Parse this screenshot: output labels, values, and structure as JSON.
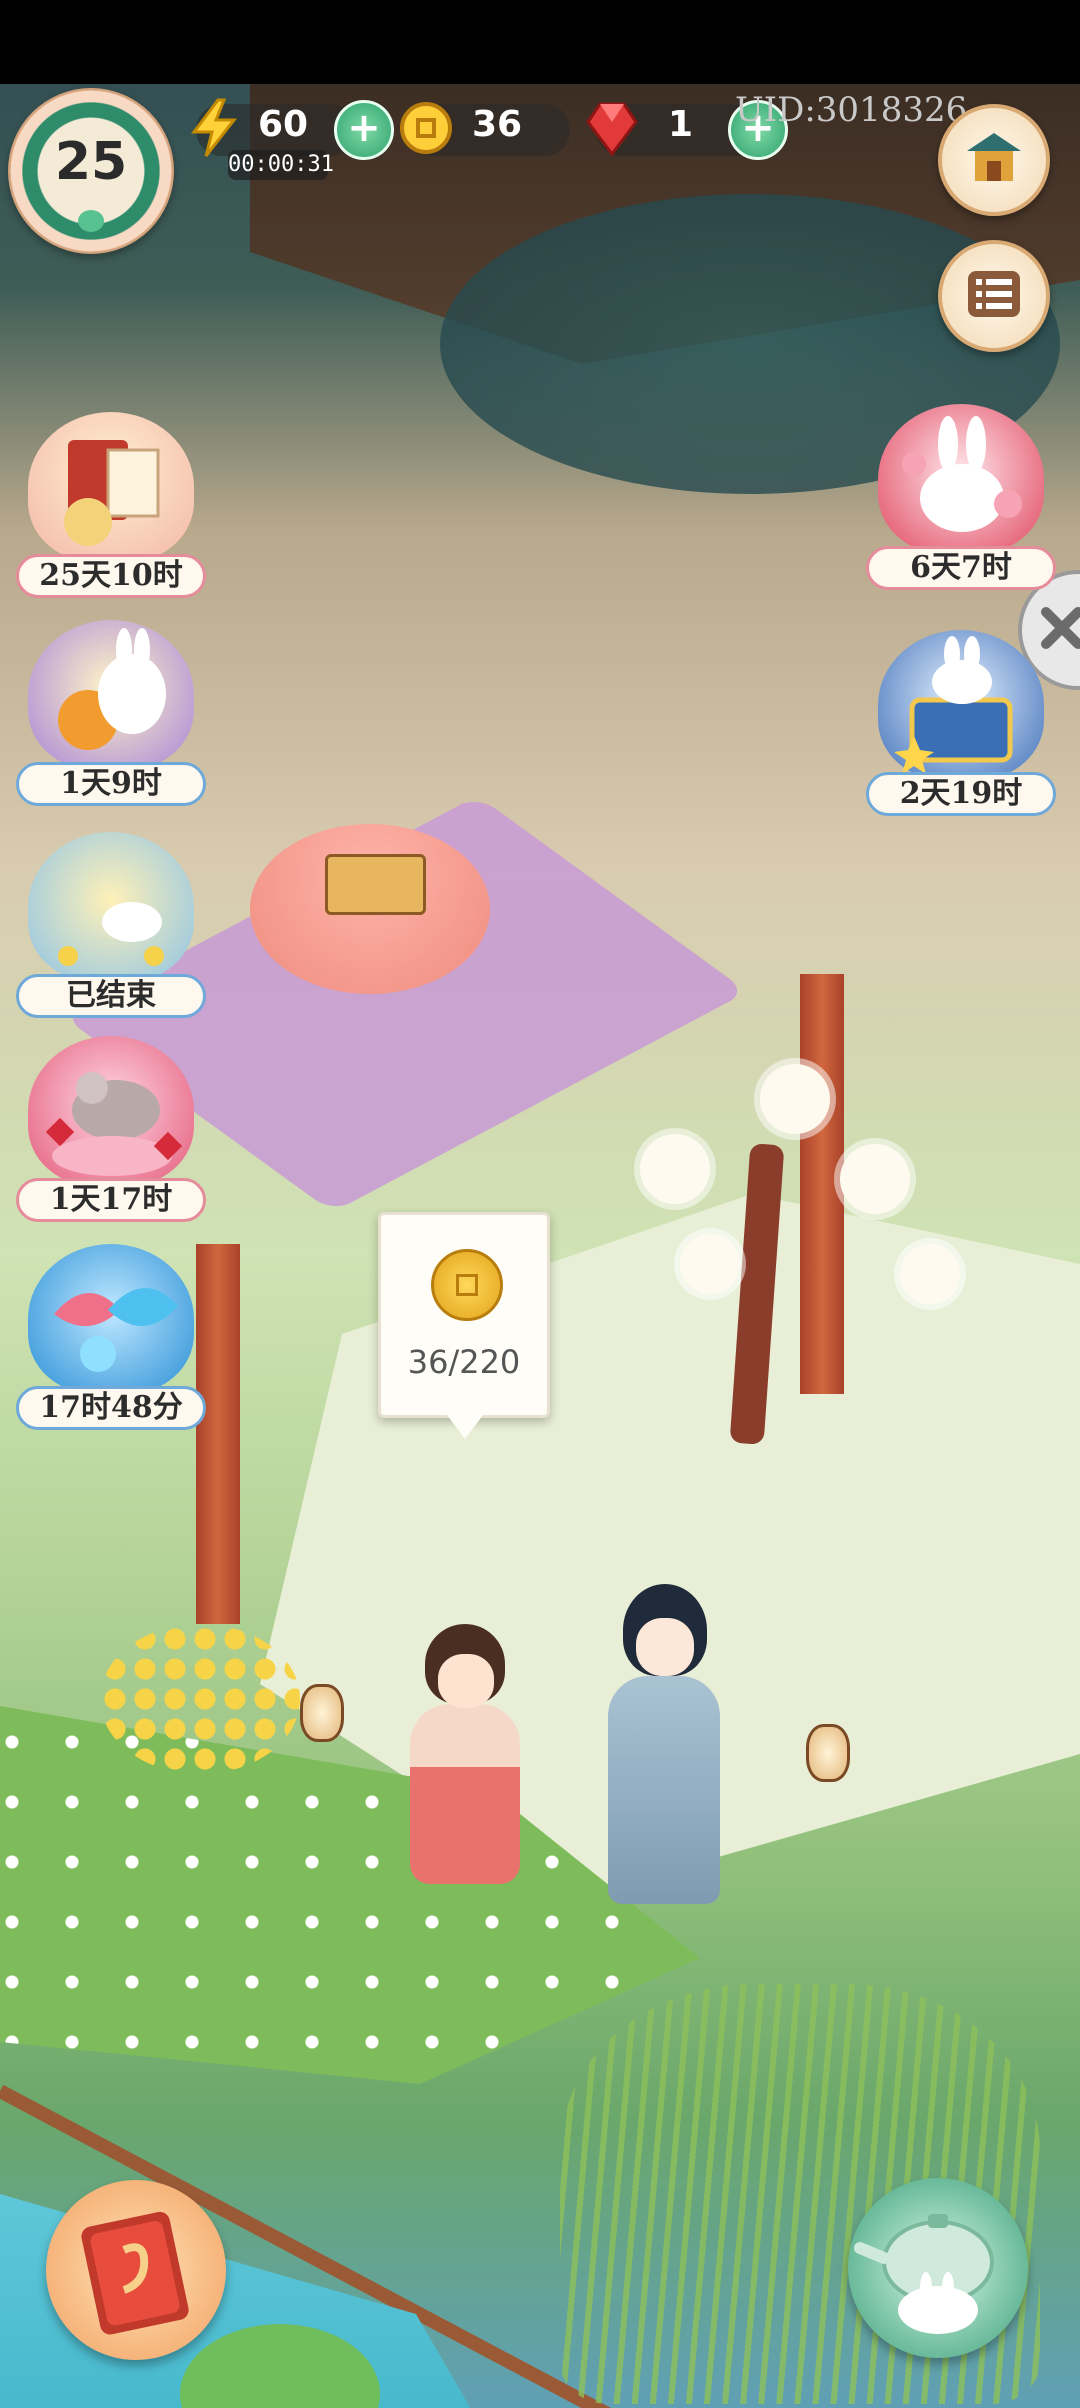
{
  "hud": {
    "level": "25",
    "energy": {
      "value": "60",
      "timer": "00:00:31",
      "add_label": "+"
    },
    "coins": {
      "value": "36"
    },
    "gems": {
      "value": "1",
      "add_label": "+"
    },
    "uid": "UID:3018326"
  },
  "events_left": [
    {
      "label": "25天10时",
      "icon": "scroll-letter-icon"
    },
    {
      "label": "1天9时",
      "icon": "rabbit-lantern-icon"
    },
    {
      "label": "已结束",
      "icon": "rabbit-moon-icon"
    },
    {
      "label": "1天17时",
      "icon": "chinchilla-icon"
    },
    {
      "label": "17时48分",
      "icon": "koi-fish-icon"
    }
  ],
  "events_right": [
    {
      "label": "6天7时",
      "icon": "rabbit-blossom-icon"
    },
    {
      "label": "2天19时",
      "icon": "rabbit-treasure-chest-icon"
    }
  ],
  "coin_tooltip": {
    "count": "36/220"
  },
  "colors": {
    "accent_green": "#2fa36e",
    "label_border_pink": "#e58c9a",
    "label_border_blue": "#6ea9d9",
    "coin_gold": "#ffd85a",
    "gem_red": "#e23a3a"
  }
}
